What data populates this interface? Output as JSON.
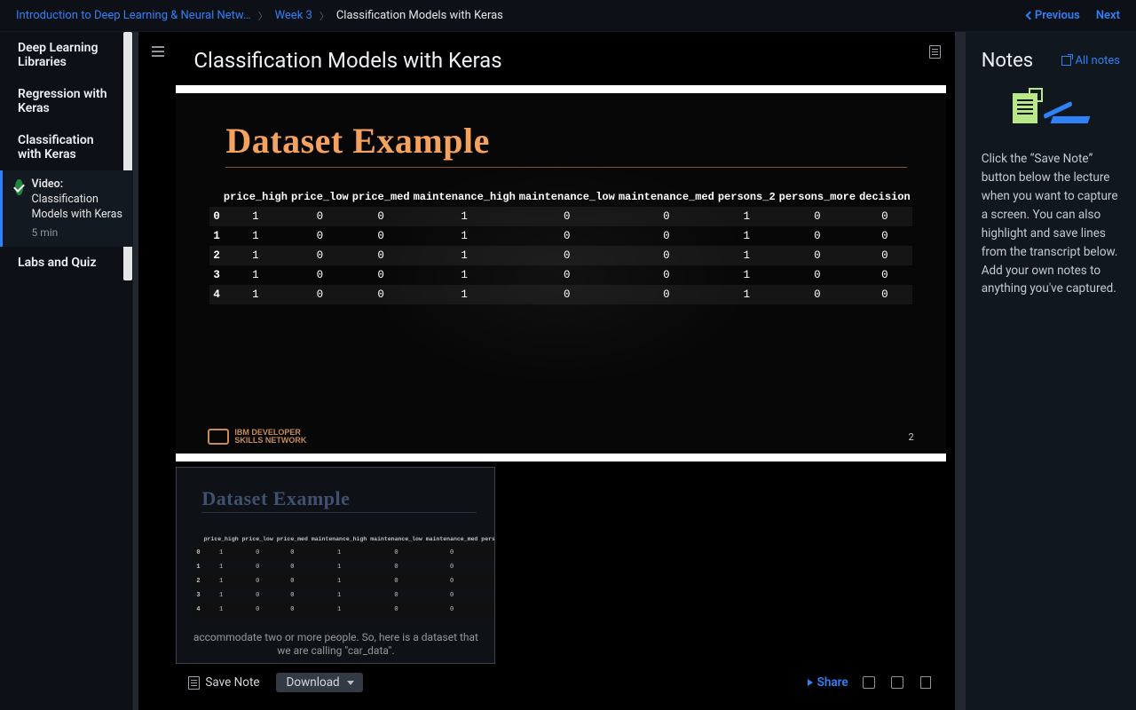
{
  "breadcrumb": {
    "course": "Introduction to Deep Learning & Neural Netw…",
    "week": "Week 3",
    "current": "Classification Models with Keras"
  },
  "topnav": {
    "previous": "Previous",
    "next": "Next"
  },
  "sidebar": {
    "items": [
      "Deep Learning Libraries",
      "Regression with Keras",
      "Classification with Keras"
    ],
    "sub": {
      "kw": "Video:",
      "title": "Classification Models with Keras",
      "meta": "5 min"
    },
    "last": "Labs and Quiz"
  },
  "page_title": "Classification Models with Keras",
  "slide": {
    "title": "Dataset Example",
    "footer_brand_line1": "IBM DEVELOPER",
    "footer_brand_line2": "SKILLS NETWORK",
    "page_number": "2"
  },
  "chart_data": {
    "type": "table",
    "columns": [
      "price_high",
      "price_low",
      "price_med",
      "maintenance_high",
      "maintenance_low",
      "maintenance_med",
      "persons_2",
      "persons_more",
      "decision"
    ],
    "index": [
      "0",
      "1",
      "2",
      "3",
      "4"
    ],
    "rows": [
      [
        1,
        0,
        0,
        1,
        0,
        0,
        1,
        0,
        0
      ],
      [
        1,
        0,
        0,
        1,
        0,
        0,
        1,
        0,
        0
      ],
      [
        1,
        0,
        0,
        1,
        0,
        0,
        1,
        0,
        0
      ],
      [
        1,
        0,
        0,
        1,
        0,
        0,
        1,
        0,
        0
      ],
      [
        1,
        0,
        0,
        1,
        0,
        0,
        1,
        0,
        0
      ]
    ]
  },
  "caption": "accommodate two or more people. So, here is a dataset that we are calling \"car_data\".",
  "actions": {
    "save_note": "Save Note",
    "download": "Download",
    "share": "Share"
  },
  "notes": {
    "title": "Notes",
    "all_notes": "All notes",
    "body": "Click the “Save Note” button below the lecture when you want to capture a screen. You can also highlight and save lines from the transcript below. Add your own notes to anything you've captured."
  }
}
